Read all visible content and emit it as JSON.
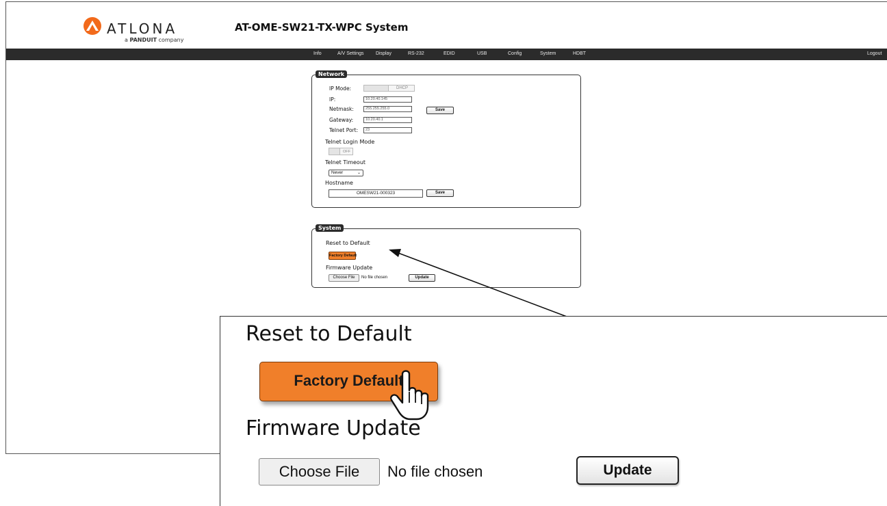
{
  "header": {
    "logo_text": "ATLONA",
    "logo_sub_prefix": "a",
    "logo_sub_brand": "PANDUIT",
    "logo_sub_suffix": "company",
    "title": "AT-OME-SW21-TX-WPC  System"
  },
  "nav": {
    "items": [
      "Info",
      "A/V Settings",
      "Display",
      "RS-232",
      "EDID",
      "USB",
      "Config",
      "System",
      "HDBT"
    ],
    "logout": "Logout"
  },
  "network": {
    "legend": "Network",
    "ip_mode_label": "IP Mode:",
    "ip_mode_value": "DHCP",
    "ip_label": "IP:",
    "ip_value": "10.20.40.145",
    "netmask_label": "Netmask:",
    "netmask_value": "255.255.255.0",
    "gateway_label": "Gateway:",
    "gateway_value": "10.20.40.1",
    "telnet_port_label": "Telnet Port:",
    "telnet_port_value": "23",
    "save_label": "Save",
    "telnet_login_mode_label": "Telnet Login Mode",
    "telnet_login_mode_value": "OFF",
    "telnet_timeout_label": "Telnet Timeout",
    "telnet_timeout_value": "Never",
    "hostname_label": "Hostname",
    "hostname_value": "OMESW21-000323",
    "hostname_save_label": "Save"
  },
  "system": {
    "legend": "System",
    "reset_label": "Reset to Default",
    "factory_default_label": "Factory Default",
    "firmware_label": "Firmware Update",
    "choose_file_label": "Choose File",
    "no_file_text": "No file chosen",
    "update_label": "Update"
  },
  "zoom": {
    "reset_label": "Reset to Default",
    "factory_default_label": "Factory Default",
    "firmware_label": "Firmware Update",
    "choose_file_label": "Choose File",
    "no_file_text": "No file chosen",
    "update_label": "Update"
  },
  "colors": {
    "accent_orange": "#f07f2a",
    "navbar": "#2b2b2b",
    "logo_orange": "#f26a1b"
  }
}
